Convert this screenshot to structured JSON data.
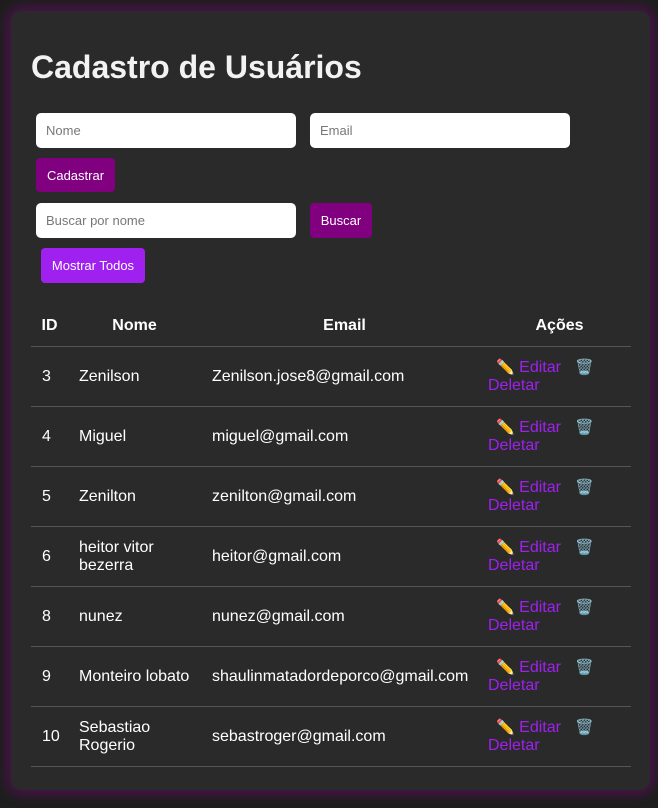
{
  "page": {
    "title": "Cadastro de Usuários"
  },
  "form": {
    "name_placeholder": "Nome",
    "email_placeholder": "Email",
    "register_label": "Cadastrar"
  },
  "search": {
    "placeholder": "Buscar por nome",
    "search_label": "Buscar",
    "show_all_label": "Mostrar Todos"
  },
  "table": {
    "headers": [
      "ID",
      "Nome",
      "Email",
      "Ações"
    ],
    "rows": [
      {
        "id": "3",
        "name": "Zenilson",
        "email": "Zenilson.jose8@gmail.com"
      },
      {
        "id": "4",
        "name": "Miguel",
        "email": "miguel@gmail.com"
      },
      {
        "id": "5",
        "name": "Zenilton",
        "email": "zenilton@gmail.com"
      },
      {
        "id": "6",
        "name": "heitor vitor bezerra",
        "email": "heitor@gmail.com"
      },
      {
        "id": "8",
        "name": "nunez",
        "email": "nunez@gmail.com"
      },
      {
        "id": "9",
        "name": "Monteiro lobato",
        "email": "shaulinmatadordeporco@gmail.com"
      },
      {
        "id": "10",
        "name": "Sebastiao Rogerio",
        "email": "sebastroger@gmail.com"
      }
    ],
    "edit_label": "Editar",
    "delete_label": "Deletar",
    "edit_icon": "pencil-icon",
    "delete_icon": "trash-icon"
  },
  "colors": {
    "accent": "#800080",
    "accent_bright": "#a020f0",
    "background": "#2a2a2a"
  }
}
